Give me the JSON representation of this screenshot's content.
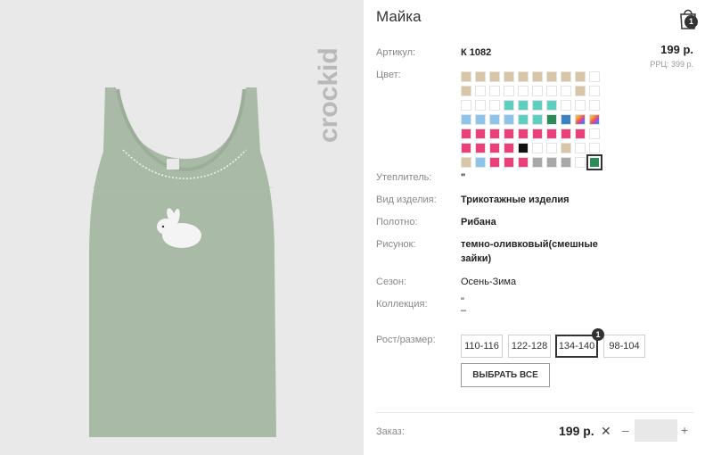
{
  "product": {
    "title": "Майка",
    "image_alt": "product photo",
    "brand_text": "crockid"
  },
  "cart": {
    "count": "1"
  },
  "price": {
    "value": "199 р.",
    "rrp": "РРЦ: 399 р."
  },
  "specs": [
    {
      "label": "Артикул:",
      "value": "К 1082"
    },
    {
      "label": "Цвет:",
      "value": ""
    },
    {
      "label": "Утеплитель:",
      "value": "\""
    },
    {
      "label": "Вид изделия:",
      "value": "Трикотажные изделия"
    },
    {
      "label": "Полотно:",
      "value": "Рибана"
    },
    {
      "label": "Рисунок:",
      "value": "темно-оливковый(смешные зайки)"
    },
    {
      "label": "Сезон:",
      "value": "Осень-Зима"
    },
    {
      "label": "Коллекция:",
      "value": "\"\n–"
    }
  ],
  "colors": [
    [
      "#d6c6a6",
      "#d6c6a6",
      "#d6c6a6",
      "#d6c6a6",
      "#d6c6a6",
      "#d6c6a6",
      "#d6c6a6",
      "#d6c6a6",
      "#d6c6a6",
      "#ffffff"
    ],
    [
      "#d6c6a6",
      "#ffffff",
      "#ffffff",
      "#ffffff",
      "#ffffff",
      "#ffffff",
      "#ffffff",
      "#ffffff",
      "#d6c6a6",
      "#ffffff"
    ],
    [
      "#ffffff",
      "#ffffff",
      "#ffffff",
      "#5ccfbf",
      "#5ccfbf",
      "#5ccfbf",
      "#5ccfbf",
      "#ffffff",
      "#ffffff",
      "#ffffff"
    ],
    [
      "#8cc4ee",
      "#8cc4ee",
      "#8cc4ee",
      "#8cc4ee",
      "#5ccfbf",
      "#5ccfbf",
      "#2e8a57",
      "#3b82c4",
      "multi",
      "multi"
    ],
    [
      "#ec3f7c",
      "#ec3f7c",
      "#ec3f7c",
      "#ec3f7c",
      "#ec3f7c",
      "#ec3f7c",
      "#ec3f7c",
      "#ec3f7c",
      "#ec3f7c",
      "#ffffff"
    ],
    [
      "#ec3f7c",
      "#ec3f7c",
      "#ec3f7c",
      "#ec3f7c",
      "#111111",
      "#ffffff",
      "#ffffff",
      "#d6c6a6",
      "#ffffff",
      "#ffffff"
    ],
    [
      "#d6c6a6",
      "#8cc4ee",
      "#ec3f7c",
      "#ec3f7c",
      "#ec3f7c",
      "#a8a8a8",
      "#a8a8a8",
      "#a8a8a8",
      "#ffffff",
      "#2e8a57"
    ]
  ],
  "selected_color": "6-9",
  "size_label": "Рост/размер:",
  "sizes": [
    {
      "label": "110-116",
      "selected": false
    },
    {
      "label": "122-128",
      "selected": false
    },
    {
      "label": "134-140",
      "selected": true,
      "count": "1"
    },
    {
      "label": "98-104",
      "selected": false
    }
  ],
  "select_all_label": "ВЫБРАТЬ ВСЕ",
  "order": {
    "label": "Заказ:",
    "price": "199 р.",
    "times": "✕",
    "minus": "–",
    "plus": "+",
    "qty": ""
  },
  "icons": {
    "cart": "shopping-bag-icon",
    "remove": "close-icon"
  }
}
